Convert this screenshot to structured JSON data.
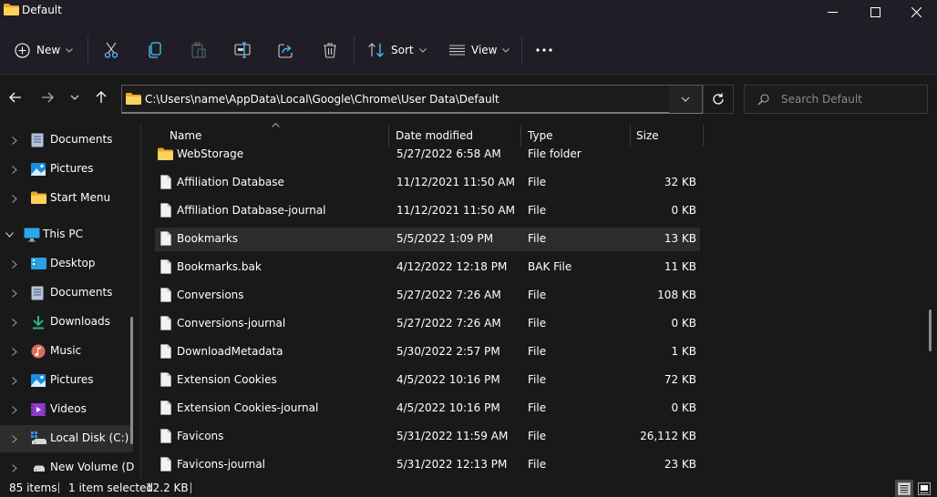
{
  "window": {
    "title": "Default",
    "controls": [
      "minimize",
      "maximize",
      "close"
    ]
  },
  "toolbar": {
    "new_label": "New",
    "sort_label": "Sort",
    "view_label": "View",
    "icons": [
      "plus-circle-icon",
      "cut-icon",
      "copy-icon",
      "paste-icon",
      "rename-icon",
      "share-icon",
      "delete-icon",
      "sort-icon",
      "view-icon",
      "more-icon"
    ]
  },
  "navigation": {
    "address": "C:\\Users\\name\\AppData\\Local\\Google\\Chrome\\User Data\\Default",
    "search_placeholder": "Search Default"
  },
  "sidebar": {
    "items": [
      {
        "label": "Documents",
        "icon": "documents-icon",
        "level": 1
      },
      {
        "label": "Pictures",
        "icon": "pictures-icon",
        "level": 1
      },
      {
        "label": "Start Menu",
        "icon": "folder-icon",
        "level": 1
      },
      {
        "label": "This PC",
        "icon": "pc-icon",
        "level": 0,
        "expanded": true
      },
      {
        "label": "Desktop",
        "icon": "desktop-icon",
        "level": 1
      },
      {
        "label": "Documents",
        "icon": "documents-icon",
        "level": 1
      },
      {
        "label": "Downloads",
        "icon": "downloads-icon",
        "level": 1
      },
      {
        "label": "Music",
        "icon": "music-icon",
        "level": 1
      },
      {
        "label": "Pictures",
        "icon": "pictures-icon",
        "level": 1
      },
      {
        "label": "Videos",
        "icon": "videos-icon",
        "level": 1
      },
      {
        "label": "Local Disk (C:)",
        "icon": "local-disk-icon",
        "level": 1,
        "selected": true
      },
      {
        "label": "New Volume (D",
        "icon": "drive-icon",
        "level": 1
      }
    ]
  },
  "file_list": {
    "columns": {
      "name": "Name",
      "date": "Date modified",
      "type": "Type",
      "size": "Size"
    },
    "sort_column": "Name",
    "rows": [
      {
        "name": "WebStorage",
        "date": "5/27/2022 6:58 AM",
        "type": "File folder",
        "size": "",
        "icon": "folder-icon"
      },
      {
        "name": "Affiliation Database",
        "date": "11/12/2021 11:50 AM",
        "type": "File",
        "size": "32 KB",
        "icon": "file-icon"
      },
      {
        "name": "Affiliation Database-journal",
        "date": "11/12/2021 11:50 AM",
        "type": "File",
        "size": "0 KB",
        "icon": "file-icon"
      },
      {
        "name": "Bookmarks",
        "date": "5/5/2022 1:09 PM",
        "type": "File",
        "size": "13 KB",
        "icon": "file-icon",
        "selected": true
      },
      {
        "name": "Bookmarks.bak",
        "date": "4/12/2022 12:18 PM",
        "type": "BAK File",
        "size": "11 KB",
        "icon": "file-icon"
      },
      {
        "name": "Conversions",
        "date": "5/27/2022 7:26 AM",
        "type": "File",
        "size": "108 KB",
        "icon": "file-icon"
      },
      {
        "name": "Conversions-journal",
        "date": "5/27/2022 7:26 AM",
        "type": "File",
        "size": "0 KB",
        "icon": "file-icon"
      },
      {
        "name": "DownloadMetadata",
        "date": "5/30/2022 2:57 PM",
        "type": "File",
        "size": "1 KB",
        "icon": "file-icon"
      },
      {
        "name": "Extension Cookies",
        "date": "4/5/2022 10:16 PM",
        "type": "File",
        "size": "72 KB",
        "icon": "file-icon"
      },
      {
        "name": "Extension Cookies-journal",
        "date": "4/5/2022 10:16 PM",
        "type": "File",
        "size": "0 KB",
        "icon": "file-icon"
      },
      {
        "name": "Favicons",
        "date": "5/31/2022 11:59 AM",
        "type": "File",
        "size": "26,112 KB",
        "icon": "file-icon"
      },
      {
        "name": "Favicons-journal",
        "date": "5/31/2022 12:13 PM",
        "type": "File",
        "size": "23 KB",
        "icon": "file-icon"
      }
    ]
  },
  "status": {
    "item_count": "85 items",
    "selection": "1 item selected",
    "selection_size": "12.2 KB",
    "view_modes": [
      "details-view-icon",
      "large-icons-view-icon"
    ],
    "active_view": "details-view-icon"
  },
  "colors": {
    "background": "#191919",
    "titlebar": "#201d26",
    "accent": "#4cc2ff",
    "folder": "#f8c948",
    "selected_row": "#2c2c2c"
  }
}
